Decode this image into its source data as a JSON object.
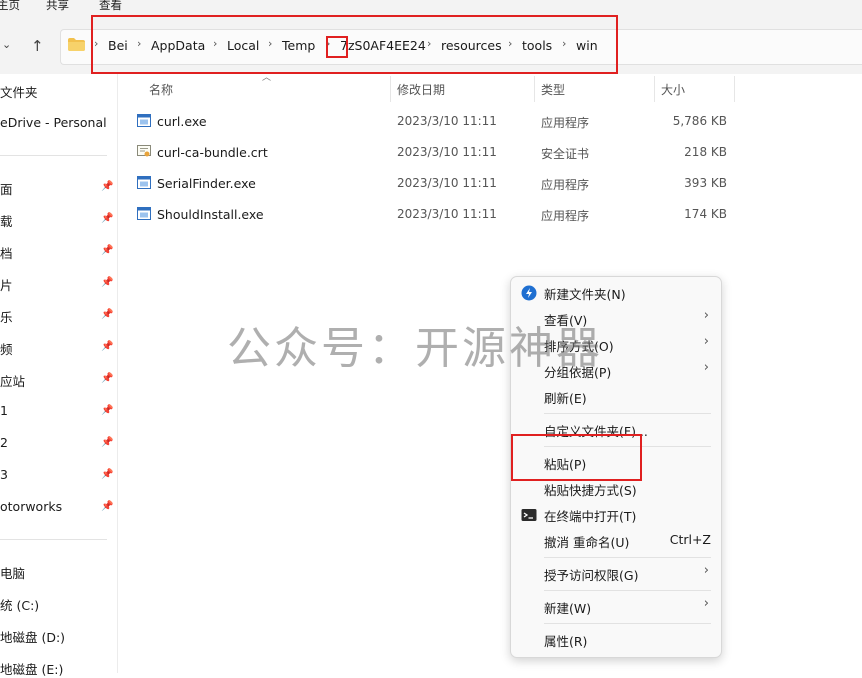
{
  "ribbon": {
    "tabs": [
      "主页",
      "共享",
      "查看"
    ]
  },
  "nav": {
    "back": "←",
    "forward": "→",
    "dropdown": "⌄",
    "up": "↑"
  },
  "breadcrumb": [
    "Bei",
    "AppData",
    "Local",
    "Temp",
    "7zS0AF4EE24",
    "resources",
    "tools",
    "win"
  ],
  "sidebar": {
    "items": [
      "文件夹",
      "eDrive - Personal",
      "面",
      "载",
      "档",
      "片",
      "乐",
      "频",
      "应站",
      "1",
      "2",
      "3",
      "otorworks",
      "电脑",
      "统 (C:)",
      "地磁盘 (D:)",
      "地磁盘 (E:)"
    ]
  },
  "columns": {
    "name": "名称",
    "date": "修改日期",
    "type": "类型",
    "size": "大小"
  },
  "files": [
    {
      "name": "curl.exe",
      "date": "2023/3/10 11:11",
      "type": "应用程序",
      "size": "5,786 KB",
      "icon": "exe-icon"
    },
    {
      "name": "curl-ca-bundle.crt",
      "date": "2023/3/10 11:11",
      "type": "安全证书",
      "size": "218 KB",
      "icon": "certificate-icon"
    },
    {
      "name": "SerialFinder.exe",
      "date": "2023/3/10 11:11",
      "type": "应用程序",
      "size": "393 KB",
      "icon": "exe-icon"
    },
    {
      "name": "ShouldInstall.exe",
      "date": "2023/3/10 11:11",
      "type": "应用程序",
      "size": "174 KB",
      "icon": "exe-icon"
    }
  ],
  "context_menu": {
    "new_folder": "新建文件夹(N)",
    "view": "查看(V)",
    "sort_by": "排序方式(O)",
    "group_by": "分组依据(P)",
    "refresh": "刷新(E)",
    "customize_folder": "自定义文件夹(F)...",
    "paste": "粘贴(P)",
    "paste_shortcut": "粘贴快捷方式(S)",
    "open_terminal": "在终端中打开(T)",
    "undo_rename": "撤消 重命名(U)",
    "undo_shortcut": "Ctrl+Z",
    "give_access": "授予访问权限(G)",
    "new": "新建(W)",
    "properties": "属性(R)"
  },
  "watermark": "公众号：开源神器",
  "colors": {
    "highlight_red": "#e02020",
    "accent_blue": "#1f6fd1"
  }
}
